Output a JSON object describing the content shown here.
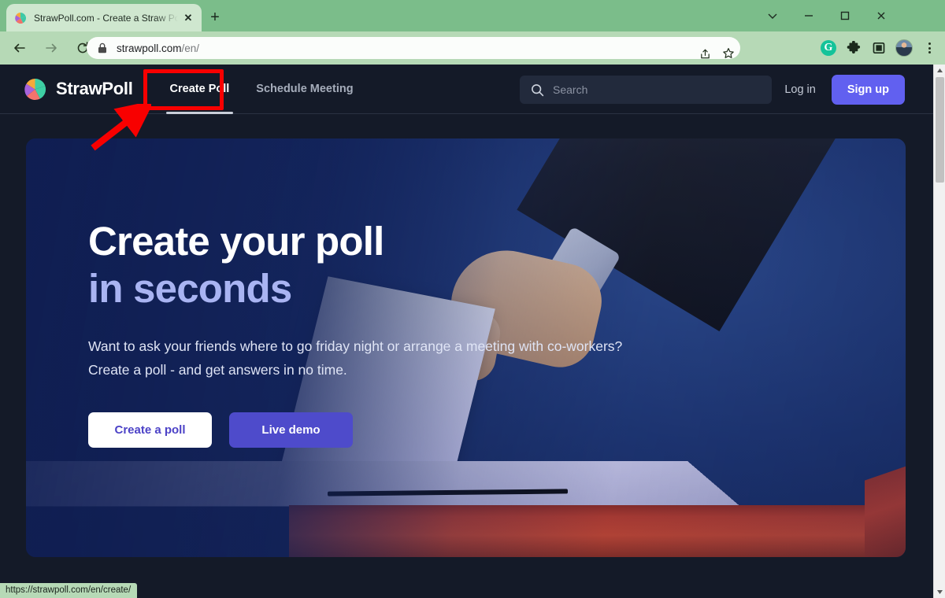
{
  "browser": {
    "tab": {
      "title": "StrawPoll.com - Create a Straw Po",
      "favicon_name": "strawpoll-pie-favicon",
      "close_label": "✕"
    },
    "new_tab_label": "+",
    "window_controls": {
      "expand": "chevron-down",
      "minimize": "minimize",
      "maximize": "maximize",
      "close": "close"
    },
    "nav": {
      "back": "back",
      "forward": "forward",
      "reload": "reload"
    },
    "omnibox": {
      "lock_name": "site-secure-lock",
      "url_host": "strawpoll.com",
      "url_path": "/en/",
      "share_label": "share",
      "bookmark_label": "bookmark-star"
    },
    "extensions": [
      {
        "name": "grammarly-extension",
        "label": "G"
      },
      {
        "name": "extensions-puzzle",
        "label": ""
      },
      {
        "name": "side-panel",
        "label": ""
      }
    ],
    "profile_label": "profile-avatar",
    "menu_label": "chrome-menu",
    "status_bubble": "https://strawpoll.com/en/create/"
  },
  "site": {
    "brand": "StrawPoll",
    "nav_links": [
      {
        "label": "Create Poll",
        "active": true
      },
      {
        "label": "Schedule Meeting",
        "active": false
      }
    ],
    "search": {
      "placeholder": "Search",
      "value": ""
    },
    "login_label": "Log in",
    "signup_label": "Sign up"
  },
  "hero": {
    "heading_line1": "Create your poll",
    "heading_line2": "in seconds",
    "lede": "Want to ask your friends where to go friday night or arrange a meeting with co-workers? Create a poll - and get answers in no time.",
    "primary_cta": "Create a poll",
    "secondary_cta": "Live demo"
  },
  "annotation": {
    "box_target": "Create Poll",
    "color": "#f80000"
  },
  "colors": {
    "page_bg": "#141a28",
    "nav_bg": "#141a28",
    "signup": "#6160f0",
    "hero_heading_accent": "#a9b4f2",
    "live_demo": "#4e4bcb",
    "create_poll_text": "#4c42c7",
    "chrome_green": "#b6d9b6",
    "tabstrip_green": "#7bbd8a"
  }
}
